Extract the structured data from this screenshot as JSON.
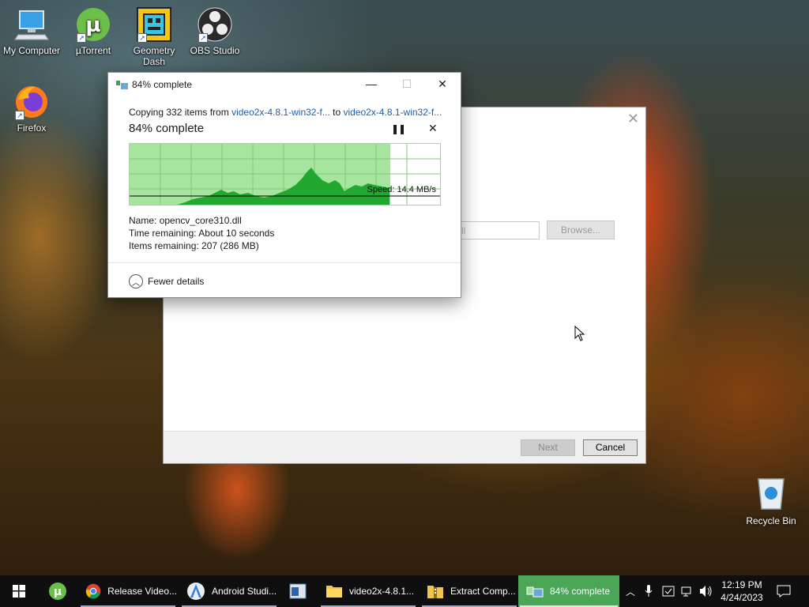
{
  "desktop": {
    "icons": [
      {
        "label": "My Computer"
      },
      {
        "label": "µTorrent"
      },
      {
        "label": "Geometry Dash"
      },
      {
        "label": "OBS Studio"
      },
      {
        "label": "Firefox"
      }
    ],
    "recycle_bin": "Recycle Bin"
  },
  "wizard": {
    "path_value": "ll",
    "browse_label": "Browse...",
    "next_label": "Next",
    "cancel_label": "Cancel"
  },
  "copy_dialog": {
    "title": "84% complete",
    "copying_prefix": "Copying 332 items from ",
    "source": "video2x-4.8.1-win32-f...",
    "to_word": " to ",
    "destination": "video2x-4.8.1-win32-f...",
    "percent_text": "84% complete",
    "progress": 0.84,
    "speed": "Speed: 14.4 MB/s",
    "name_label": "Name:",
    "name_value": "opencv_core310.dll",
    "time_label": "Time remaining:",
    "time_value": "About 10 seconds",
    "items_label": "Items remaining:",
    "items_value": "207 (286 MB)",
    "fewer_details": "Fewer details"
  },
  "taskbar": {
    "items": [
      {
        "label": "Release Video..."
      },
      {
        "label": "Android Studi..."
      },
      {
        "label": "video2x-4.8.1..."
      },
      {
        "label": "Extract Comp..."
      },
      {
        "label": "84% complete"
      }
    ],
    "time": "12:19 PM",
    "date": "4/24/2023"
  },
  "colors": {
    "progress_fill": "#a6e59e",
    "graph_fill": "#22a82f",
    "taskbar_active": "#4ba556",
    "link": "#1d5fa9"
  }
}
